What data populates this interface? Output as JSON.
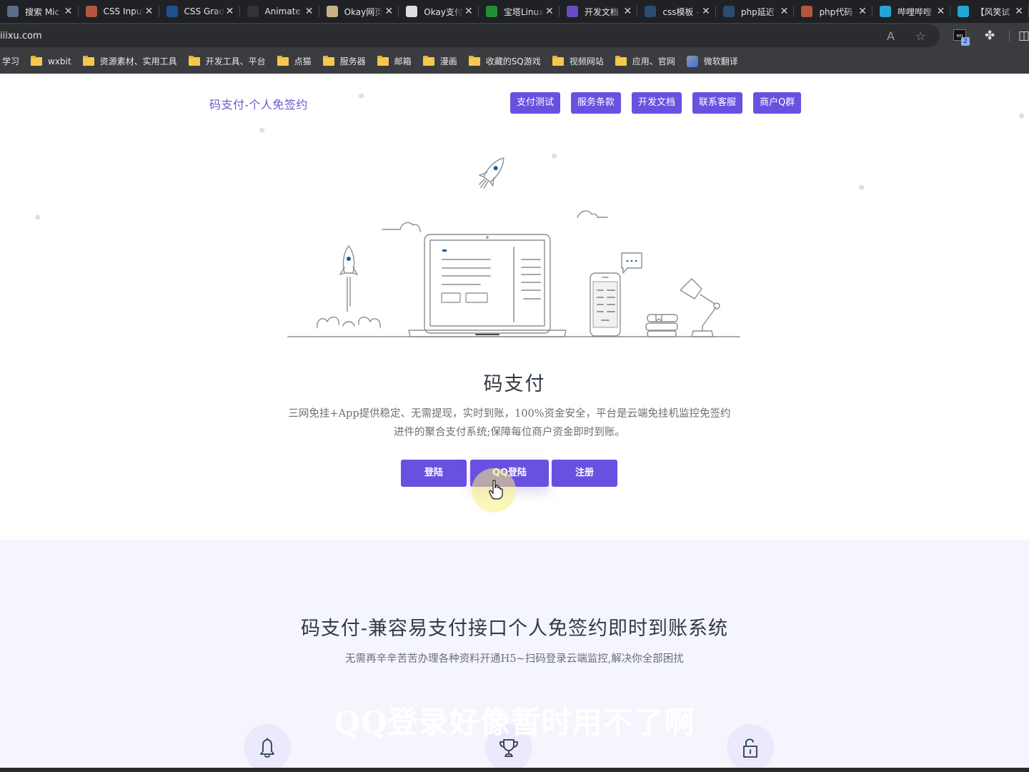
{
  "browser": {
    "tabs": [
      {
        "title": "搜索 Mic",
        "icon": "bing-search-icon",
        "color": "#5b6b8a"
      },
      {
        "title": "CSS Input",
        "icon": "c-logo-icon",
        "color": "#b3553f"
      },
      {
        "title": "CSS Grad",
        "icon": "globe-dark-icon",
        "color": "#1f4f8f"
      },
      {
        "title": "Animate.",
        "icon": "a-logo-icon",
        "color": "#333333"
      },
      {
        "title": "Okay网页",
        "icon": "image-thumb-icon",
        "color": "#c9b28a"
      },
      {
        "title": "Okay支付",
        "icon": "document-icon",
        "color": "#dddddd"
      },
      {
        "title": "宝塔Linux",
        "icon": "shield-green-icon",
        "color": "#1f8f3a"
      },
      {
        "title": "开发文档",
        "icon": "purple-logo-icon",
        "color": "#6a4bc7"
      },
      {
        "title": "css模板 -",
        "icon": "search-icon",
        "color": "#2c4b6e"
      },
      {
        "title": "php延迟",
        "icon": "search-icon",
        "color": "#2c4b6e"
      },
      {
        "title": "php代码",
        "icon": "c-logo-icon",
        "color": "#b3553f"
      },
      {
        "title": "哔哩哔哩",
        "icon": "bilibili-icon",
        "color": "#22a6d6"
      },
      {
        "title": "【风笑试",
        "icon": "bilibili-icon",
        "color": "#22a6d6"
      }
    ],
    "close_glyph": "✕",
    "url": "iiixu.com",
    "extension_badge_count": "2",
    "extension_badge_label": "en",
    "bookmarks": [
      {
        "label": "学习",
        "type": "text"
      },
      {
        "label": "wxbit",
        "type": "folder"
      },
      {
        "label": "资源素材、实用工具",
        "type": "folder"
      },
      {
        "label": "开发工具、平台",
        "type": "folder"
      },
      {
        "label": "点猫",
        "type": "folder"
      },
      {
        "label": "服务器",
        "type": "folder"
      },
      {
        "label": "邮箱",
        "type": "folder"
      },
      {
        "label": "漫画",
        "type": "folder"
      },
      {
        "label": "收藏的SQ游戏",
        "type": "folder"
      },
      {
        "label": "视频网站",
        "type": "folder"
      },
      {
        "label": "应用、官网",
        "type": "folder"
      },
      {
        "label": "微软翻译",
        "type": "link"
      }
    ]
  },
  "site": {
    "brand": "码支付-个人免签约",
    "nav": [
      "支付测试",
      "服务条款",
      "开发文档",
      "联系客服",
      "商户Q群"
    ],
    "accent_color": "#6a50e0",
    "hero": {
      "title": "码支付",
      "description": "三网免挂+App提供稳定、无需提现，实时到账，100%资金安全，平台是云端免挂机监控免签约进件的聚合支付系统;保障每位商户资金即时到账。",
      "buttons": [
        "登陆",
        "QQ登陆",
        "注册"
      ]
    },
    "section2": {
      "title": "码支付-兼容易支付接口个人免签约即时到账系统",
      "subtitle": "无需再辛辛苦苦办理各种资料开通H5~扫码登录云端监控,解决你全部困扰",
      "features": [
        {
          "icon": "bell-icon"
        },
        {
          "icon": "trophy-icon"
        },
        {
          "icon": "unlock-icon"
        }
      ]
    },
    "video_caption": "QQ登录好像暂时用不了啊"
  }
}
